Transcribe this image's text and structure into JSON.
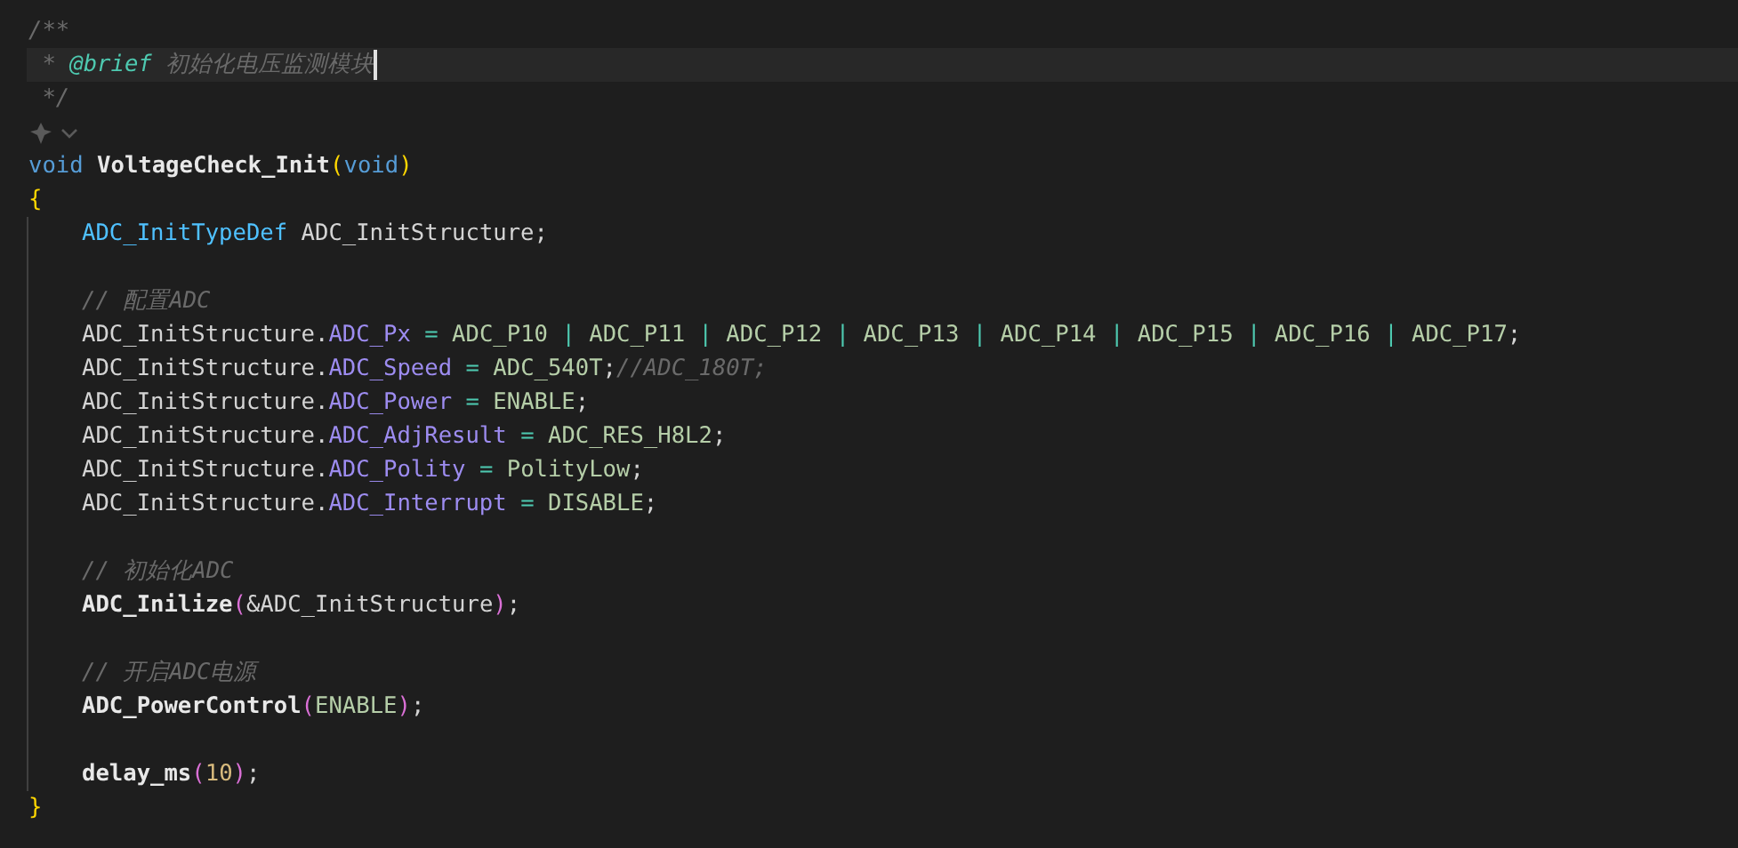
{
  "editor": {
    "lines": [
      {
        "kind": "code",
        "indented": false,
        "current": false,
        "tokens": [
          {
            "kind": "comment",
            "text": "/**"
          }
        ]
      },
      {
        "kind": "code",
        "indented": false,
        "current": true,
        "tokens": [
          {
            "kind": "comment",
            "text": " * "
          },
          {
            "kind": "tag",
            "text": "@brief"
          },
          {
            "kind": "comment",
            "text": " 初始化电压监测模块"
          }
        ]
      },
      {
        "kind": "code",
        "indented": false,
        "current": false,
        "tokens": [
          {
            "kind": "comment",
            "text": " */"
          }
        ]
      },
      {
        "kind": "codelens"
      },
      {
        "kind": "code",
        "indented": false,
        "current": false,
        "tokens": [
          {
            "kind": "keyword",
            "text": "void "
          },
          {
            "kind": "func",
            "text": "VoltageCheck_Init"
          },
          {
            "kind": "paren1",
            "text": "("
          },
          {
            "kind": "keyword",
            "text": "void"
          },
          {
            "kind": "paren1",
            "text": ")"
          }
        ]
      },
      {
        "kind": "code",
        "indented": false,
        "current": false,
        "tokens": [
          {
            "kind": "paren1",
            "text": "{"
          }
        ]
      },
      {
        "kind": "code",
        "indented": true,
        "current": false,
        "tokens": [
          {
            "kind": "type",
            "text": "ADC_InitTypeDef"
          },
          {
            "kind": "var",
            "text": " ADC_InitStructure;"
          }
        ]
      },
      {
        "kind": "code",
        "indented": true,
        "current": false
      },
      {
        "kind": "code",
        "indented": true,
        "current": false,
        "tokens": [
          {
            "kind": "comment",
            "text": "// 配置ADC"
          }
        ]
      },
      {
        "kind": "code",
        "indented": true,
        "current": false,
        "tokens": [
          {
            "kind": "var",
            "text": "ADC_InitStructure."
          },
          {
            "kind": "member",
            "text": "ADC_Px"
          },
          {
            "kind": "op",
            "text": " = "
          },
          {
            "kind": "const",
            "text": "ADC_P10"
          },
          {
            "kind": "op",
            "text": " | "
          },
          {
            "kind": "const",
            "text": "ADC_P11"
          },
          {
            "kind": "op",
            "text": " | "
          },
          {
            "kind": "const",
            "text": "ADC_P12"
          },
          {
            "kind": "op",
            "text": " | "
          },
          {
            "kind": "const",
            "text": "ADC_P13"
          },
          {
            "kind": "op",
            "text": " | "
          },
          {
            "kind": "const",
            "text": "ADC_P14"
          },
          {
            "kind": "op",
            "text": " | "
          },
          {
            "kind": "const",
            "text": "ADC_P15"
          },
          {
            "kind": "op",
            "text": " | "
          },
          {
            "kind": "const",
            "text": "ADC_P16"
          },
          {
            "kind": "op",
            "text": " | "
          },
          {
            "kind": "const",
            "text": "ADC_P17"
          },
          {
            "kind": "var",
            "text": ";"
          }
        ]
      },
      {
        "kind": "code",
        "indented": true,
        "current": false,
        "tokens": [
          {
            "kind": "var",
            "text": "ADC_InitStructure."
          },
          {
            "kind": "member",
            "text": "ADC_Speed"
          },
          {
            "kind": "op",
            "text": " = "
          },
          {
            "kind": "const",
            "text": "ADC_540T"
          },
          {
            "kind": "var",
            "text": ";"
          },
          {
            "kind": "comment",
            "text": "//ADC_180T;"
          }
        ]
      },
      {
        "kind": "code",
        "indented": true,
        "current": false,
        "tokens": [
          {
            "kind": "var",
            "text": "ADC_InitStructure."
          },
          {
            "kind": "member",
            "text": "ADC_Power"
          },
          {
            "kind": "op",
            "text": " = "
          },
          {
            "kind": "const",
            "text": "ENABLE"
          },
          {
            "kind": "var",
            "text": ";"
          }
        ]
      },
      {
        "kind": "code",
        "indented": true,
        "current": false,
        "tokens": [
          {
            "kind": "var",
            "text": "ADC_InitStructure."
          },
          {
            "kind": "member",
            "text": "ADC_AdjResult"
          },
          {
            "kind": "op",
            "text": " = "
          },
          {
            "kind": "const",
            "text": "ADC_RES_H8L2"
          },
          {
            "kind": "var",
            "text": ";"
          }
        ]
      },
      {
        "kind": "code",
        "indented": true,
        "current": false,
        "tokens": [
          {
            "kind": "var",
            "text": "ADC_InitStructure."
          },
          {
            "kind": "member",
            "text": "ADC_Polity"
          },
          {
            "kind": "op",
            "text": " = "
          },
          {
            "kind": "const",
            "text": "PolityLow"
          },
          {
            "kind": "var",
            "text": ";"
          }
        ]
      },
      {
        "kind": "code",
        "indented": true,
        "current": false,
        "tokens": [
          {
            "kind": "var",
            "text": "ADC_InitStructure."
          },
          {
            "kind": "member",
            "text": "ADC_Interrupt"
          },
          {
            "kind": "op",
            "text": " = "
          },
          {
            "kind": "const",
            "text": "DISABLE"
          },
          {
            "kind": "var",
            "text": ";"
          }
        ]
      },
      {
        "kind": "code",
        "indented": true,
        "current": false
      },
      {
        "kind": "code",
        "indented": true,
        "current": false,
        "tokens": [
          {
            "kind": "comment",
            "text": "// 初始化ADC"
          }
        ]
      },
      {
        "kind": "code",
        "indented": true,
        "current": false,
        "tokens": [
          {
            "kind": "func",
            "text": "ADC_Inilize"
          },
          {
            "kind": "paren2",
            "text": "("
          },
          {
            "kind": "var",
            "text": "&ADC_InitStructure"
          },
          {
            "kind": "paren2",
            "text": ")"
          },
          {
            "kind": "var",
            "text": ";"
          }
        ]
      },
      {
        "kind": "code",
        "indented": true,
        "current": false
      },
      {
        "kind": "code",
        "indented": true,
        "current": false,
        "tokens": [
          {
            "kind": "comment",
            "text": "// 开启ADC电源"
          }
        ]
      },
      {
        "kind": "code",
        "indented": true,
        "current": false,
        "tokens": [
          {
            "kind": "func",
            "text": "ADC_PowerControl"
          },
          {
            "kind": "paren2",
            "text": "("
          },
          {
            "kind": "const",
            "text": "ENABLE"
          },
          {
            "kind": "paren2",
            "text": ")"
          },
          {
            "kind": "var",
            "text": ";"
          }
        ]
      },
      {
        "kind": "code",
        "indented": true,
        "current": false
      },
      {
        "kind": "code",
        "indented": true,
        "current": false,
        "tokens": [
          {
            "kind": "func",
            "text": "delay_ms"
          },
          {
            "kind": "paren2",
            "text": "("
          },
          {
            "kind": "number",
            "text": "10"
          },
          {
            "kind": "paren2",
            "text": ")"
          },
          {
            "kind": "var",
            "text": ";"
          }
        ]
      },
      {
        "kind": "code",
        "indented": false,
        "current": false,
        "tokens": [
          {
            "kind": "paren1",
            "text": "}"
          }
        ]
      }
    ]
  }
}
